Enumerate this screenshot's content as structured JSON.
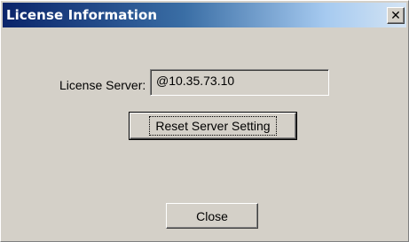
{
  "window": {
    "title": "License Information",
    "close_glyph": "✕"
  },
  "form": {
    "license_server_label": "License Server:",
    "license_server_value": "@10.35.73.10"
  },
  "buttons": {
    "reset_label": "Reset Server Setting",
    "close_label": "Close"
  },
  "colors": {
    "dialog_bg": "#d4d0c8",
    "titlebar_start": "#0a246a",
    "titlebar_end": "#d4e4f4"
  }
}
